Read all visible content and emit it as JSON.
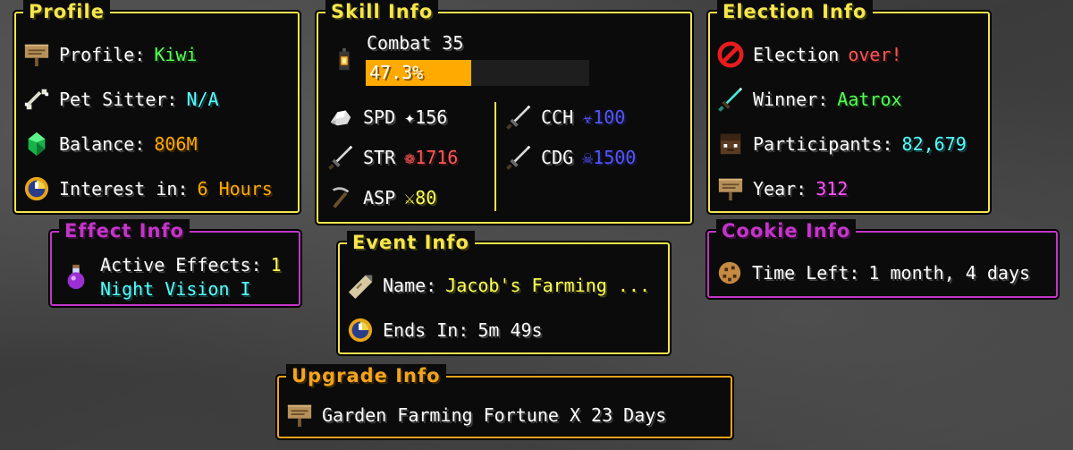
{
  "profile": {
    "title": "Profile",
    "profile_label": "Profile:",
    "profile_value": "Kiwi",
    "pet_label": "Pet Sitter:",
    "pet_value": "N/A",
    "balance_label": "Balance:",
    "balance_value": "806M",
    "interest_label": "Interest in:",
    "interest_value": "6 Hours"
  },
  "skill": {
    "title": "Skill Info",
    "name": "Combat 35",
    "progress_text": "47.3%",
    "progress": 0.473,
    "spd_label": "SPD",
    "spd_value": "✦156",
    "str_label": "STR",
    "str_value": "❁1716",
    "asp_label": "ASP",
    "asp_value": "⚔80",
    "cch_label": "CCH",
    "cch_value": "☣100",
    "cdg_label": "CDG",
    "cdg_value": "☠1500"
  },
  "election": {
    "title": "Election Info",
    "election_label": "Election",
    "election_value": "over!",
    "winner_label": "Winner:",
    "winner_value": "Aatrox",
    "participants_label": "Participants:",
    "participants_value": "82,679",
    "year_label": "Year:",
    "year_value": "312"
  },
  "effect": {
    "title": "Effect Info",
    "active_label": "Active Effects:",
    "active_value": "1",
    "effect_name": "Night Vision I"
  },
  "event": {
    "title": "Event Info",
    "name_label": "Name:",
    "name_value": "Jacob's Farming ...",
    "ends_label": "Ends In:",
    "ends_value": "5m 49s"
  },
  "cookie": {
    "title": "Cookie Info",
    "time_label": "Time Left:",
    "time_value": "1 month, 4 days"
  },
  "upgrade": {
    "title": "Upgrade Info",
    "text": "Garden Farming Fortune X 23 Days"
  },
  "colors": {
    "yellow_border": "#f5e64c",
    "magenta_border": "#c236c7",
    "orange_border": "#f2a41c",
    "progress_fill": "#ffaa00"
  }
}
